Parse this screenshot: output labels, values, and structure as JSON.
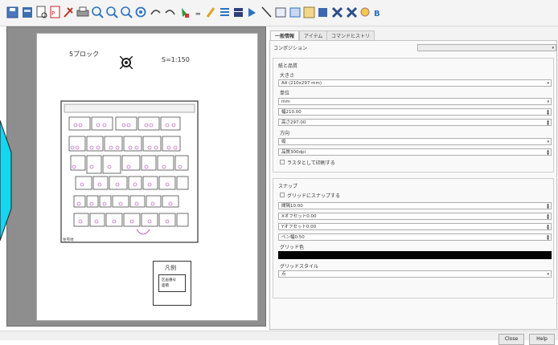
{
  "toolbar": {
    "icons": [
      "save-icon",
      "layer-icon",
      "print-preview-icon",
      "pdf-icon",
      "tools-icon",
      "print-icon",
      "zoom-fit-icon",
      "zoom-in-icon",
      "zoom-out-icon",
      "refresh-icon",
      "undo-icon",
      "redo-icon",
      "add-item-icon",
      "separator-icon",
      "pen-icon",
      "list-icon",
      "table-icon",
      "arrow-icon",
      "line-icon",
      "text-box-icon",
      "image-icon",
      "picture-icon",
      "group-icon",
      "ungroup-icon",
      "find-icon",
      "bold-icon"
    ]
  },
  "page": {
    "block_title": "5ブロック",
    "scale": "S=1:150",
    "legend_title": "凡例",
    "legend_line1": "区画番号",
    "legend_line2": "面積",
    "bottom_label": "住宅地"
  },
  "panel": {
    "tabs": [
      "一般情報",
      "アイテム",
      "コマンドヒストリ"
    ],
    "active_tab": 0,
    "composition_label": "コンポジション",
    "composition_value": "",
    "paper_section": "紙と品質",
    "size_label": "大きさ",
    "size_value": "A4 (210x297 mm)",
    "unit_label": "単位",
    "unit_value": "mm",
    "width_value": "幅210.00",
    "height_value": "高さ297.00",
    "orientation_label": "方向",
    "orientation_value": "縦",
    "quality_value": "品質300dpi",
    "raster_label": "ラスタとして印刷する",
    "snap_section": "スナップ",
    "snap_grid_label": "グリッドにスナップする",
    "spacing_value": "間隔10.00",
    "x_offset_value": "Xオフセット0.00",
    "y_offset_value": "Yオフセット0.00",
    "pen_width_value": "ペン幅0.50",
    "grid_color_label": "グリッド色",
    "grid_color": "#000000",
    "grid_style_label": "グリッドスタイル",
    "grid_style_value": "点"
  },
  "buttons": {
    "close": "Close",
    "help": "Help"
  }
}
